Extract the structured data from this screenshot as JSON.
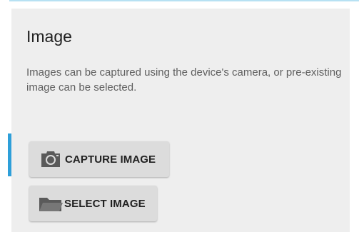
{
  "card": {
    "title": "Image",
    "description": "Images can be captured using the device's camera, or pre-existing image can be selected."
  },
  "buttons": {
    "capture": {
      "label": "CAPTURE IMAGE",
      "icon": "camera-icon"
    },
    "select": {
      "label": "SELECT IMAGE",
      "icon": "folder-icon"
    }
  },
  "colors": {
    "accent": "#2e9fd9",
    "card_background": "#eeeeee",
    "button_background": "#dcdcdc",
    "icon": "#5a5a5a"
  }
}
